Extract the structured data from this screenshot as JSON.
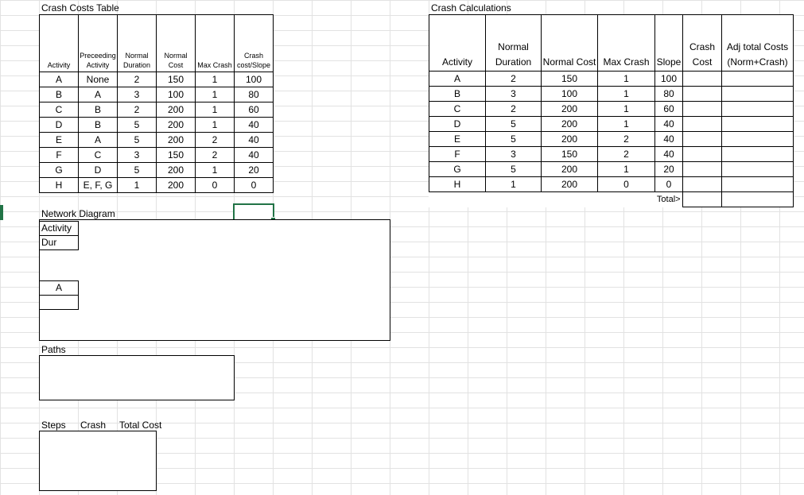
{
  "crash_costs_table": {
    "title": "Crash Costs Table",
    "headers": [
      "Activity",
      "Preceeding Activity",
      "Normal Duration",
      "Normal Cost",
      "Max Crash",
      "Crash cost/Slope"
    ],
    "rows": [
      [
        "A",
        "None",
        "2",
        "150",
        "1",
        "100"
      ],
      [
        "B",
        "A",
        "3",
        "100",
        "1",
        "80"
      ],
      [
        "C",
        "B",
        "2",
        "200",
        "1",
        "60"
      ],
      [
        "D",
        "B",
        "5",
        "200",
        "1",
        "40"
      ],
      [
        "E",
        "A",
        "5",
        "200",
        "2",
        "40"
      ],
      [
        "F",
        "C",
        "3",
        "150",
        "2",
        "40"
      ],
      [
        "G",
        "D",
        "5",
        "200",
        "1",
        "20"
      ],
      [
        "H",
        "E, F, G",
        "1",
        "200",
        "0",
        "0"
      ]
    ]
  },
  "crash_calculations": {
    "title": "Crash Calculations",
    "headers": [
      "Activity",
      "Normal Duration",
      "Normal Cost",
      "Max Crash",
      "Slope",
      "Crash Cost",
      "Adj total Costs (Norm+Crash)"
    ],
    "rows": [
      [
        "A",
        "2",
        "150",
        "1",
        "100",
        "",
        ""
      ],
      [
        "B",
        "3",
        "100",
        "1",
        "80",
        "",
        ""
      ],
      [
        "C",
        "2",
        "200",
        "1",
        "60",
        "",
        ""
      ],
      [
        "D",
        "5",
        "200",
        "1",
        "40",
        "",
        ""
      ],
      [
        "E",
        "5",
        "200",
        "2",
        "40",
        "",
        ""
      ],
      [
        "F",
        "3",
        "150",
        "2",
        "40",
        "",
        ""
      ],
      [
        "G",
        "5",
        "200",
        "1",
        "20",
        "",
        ""
      ],
      [
        "H",
        "1",
        "200",
        "0",
        "0",
        "",
        ""
      ]
    ],
    "total_label": "Total>"
  },
  "network_diagram": {
    "title": "Network Diagram",
    "legend_activity": "Activity",
    "legend_dur": "Dur",
    "node_a_label": "A"
  },
  "paths": {
    "title": "Paths"
  },
  "steps": {
    "col1": "Steps",
    "col2": "Crash",
    "col3": "Total Cost"
  },
  "colors": {
    "selection": "#217346",
    "gridline": "#e2e2e2"
  }
}
